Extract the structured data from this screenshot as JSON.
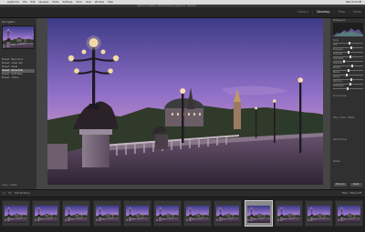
{
  "menu_bar": {
    "items": [
      "",
      "Lightroom",
      "File",
      "Edit",
      "Develop",
      "Photo",
      "Settings",
      "Tools",
      "View",
      "Window",
      "Help"
    ],
    "status": "Wed 4:21 PM"
  },
  "window": {
    "title": "Lightroom Catalog - Adobe Photoshop Lightroom - Develop"
  },
  "modules": {
    "items": [
      {
        "label": "Library",
        "active": false
      },
      {
        "label": "Develop",
        "active": true
      },
      {
        "label": "Map",
        "active": false
      },
      {
        "label": "Book",
        "active": false
      }
    ]
  },
  "left_panel": {
    "navigator_label": "Navigator",
    "presets": [
      {
        "label": "Preset - Blue Hour",
        "selected": false
      },
      {
        "label": "Preset - Clear Sky",
        "selected": false
      },
      {
        "label": "Preset - Dusk",
        "selected": false
      },
      {
        "label": "Preset - Paris Pink",
        "selected": true
      },
      {
        "label": "Preset - Soft Fade",
        "selected": false
      },
      {
        "label": "Preset - Urban",
        "selected": false
      }
    ],
    "footer": "Copy...   Paste"
  },
  "right_panel": {
    "histogram_label": "Histogram",
    "sliders": [
      {
        "label": "Temp",
        "value": 0.55
      },
      {
        "label": "Tint",
        "value": 0.62
      },
      {
        "label": "Exposure",
        "value": 0.5
      },
      {
        "label": "Contrast",
        "value": 0.58
      },
      {
        "label": "Highlights",
        "value": 0.35
      },
      {
        "label": "Shadows",
        "value": 0.66
      },
      {
        "label": "Whites",
        "value": 0.52
      },
      {
        "label": "Blacks",
        "value": 0.44
      },
      {
        "label": "Clarity",
        "value": 0.6
      },
      {
        "label": "Vibrance",
        "value": 0.57
      },
      {
        "label": "Saturation",
        "value": 0.49
      }
    ],
    "sections": [
      "Tone Curve",
      "HSL / Color / B&W",
      "Split Toning",
      "Detail"
    ],
    "buttons": [
      "Previous",
      "Reset"
    ]
  },
  "toolbar": {
    "tools": [
      "[ ]",
      "Y|Y",
      "Soft Proofing"
    ],
    "filter": "Filter :  Filters Off"
  },
  "filmstrip": {
    "thumbnails": 12,
    "selected_index": 8
  },
  "colors": {
    "sky_top": "#3d3b87",
    "sky_mid": "#8f6fc7",
    "sky_horizon": "#e4a9c9",
    "panel": "#303030",
    "selected_thumb": "#8a8a8a"
  }
}
